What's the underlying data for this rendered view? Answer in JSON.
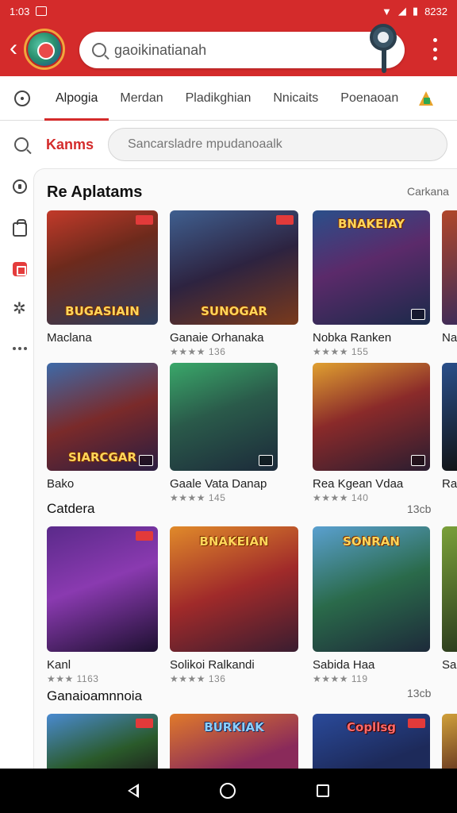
{
  "status_bar": {
    "time": "1:03",
    "clock_right": "8232"
  },
  "header": {
    "search_value": "gaoikinatianah",
    "search_placeholder": "gaoikinatianah"
  },
  "tabs": [
    {
      "label": "Alpogia",
      "active": true
    },
    {
      "label": "Merdan",
      "active": false
    },
    {
      "label": "Pladikghian",
      "active": false
    },
    {
      "label": "Nnicaits",
      "active": false
    },
    {
      "label": "Poenaoan",
      "active": false
    }
  ],
  "filter": {
    "label": "Kanms",
    "placeholder": "Sancarsladre mpudanoaalk"
  },
  "sections": {
    "top": {
      "title": "Re Aplatams",
      "see_all": "Carkana"
    },
    "second": {
      "title": "Catdera",
      "see_all": "13cb"
    },
    "third": {
      "title": "Ganaioamnnoia",
      "see_all": "13cb"
    }
  },
  "games": [
    {
      "name": "Maclana",
      "meta": "",
      "art": "BUGASIAIN"
    },
    {
      "name": "Ganaie Orhanaka",
      "meta": "★★★★ 136",
      "art": "SUNOGAR"
    },
    {
      "name": "Nobka Ranken",
      "meta": "★★★★ 155",
      "art": "BNAKEIAY"
    },
    {
      "name": "Na",
      "meta": "",
      "art": ""
    },
    {
      "name": "Bako",
      "meta": "",
      "art": "SIARCGAR"
    },
    {
      "name": "Gaale Vata Danap",
      "meta": "★★★★ 145",
      "art": ""
    },
    {
      "name": "Rea Kgean Vdaa",
      "meta": "★★★★ 140",
      "art": ""
    },
    {
      "name": "Ra",
      "meta": "",
      "art": ""
    },
    {
      "name": "Kanl",
      "meta": "★★★ 1163",
      "art": ""
    },
    {
      "name": "Solikoi Ralkandi",
      "meta": "★★★★ 136",
      "art": "BNAKEIAN"
    },
    {
      "name": "Sabida Haa",
      "meta": "★★★★ 119",
      "art": "SONRAN"
    },
    {
      "name": "Sa",
      "meta": "",
      "art": ""
    },
    {
      "name": "",
      "meta": "",
      "art": ""
    },
    {
      "name": "",
      "meta": "",
      "art": "BURKIAK"
    },
    {
      "name": "",
      "meta": "",
      "art": "Copllsg"
    }
  ],
  "colors": {
    "accent": "#d42b2b",
    "navbar": "#000000"
  }
}
